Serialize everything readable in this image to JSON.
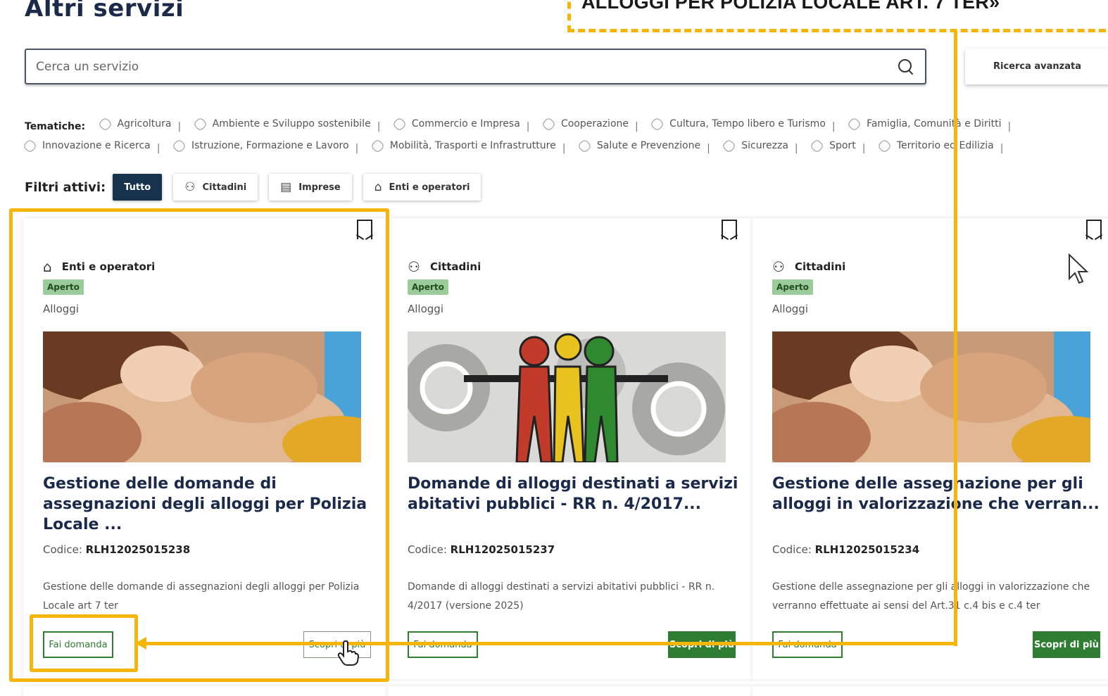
{
  "page": {
    "title": "Altri servizi"
  },
  "callout": {
    "text": "ALLOGGI PER POLIZIA LOCALE ART. 7 TER»"
  },
  "search": {
    "placeholder": "Cerca un servizio",
    "advanced_label": "Ricerca avanzata"
  },
  "themes": {
    "label": "Tematiche:",
    "items": [
      "Agricoltura",
      "Ambiente e Sviluppo sostenibile",
      "Commercio e Impresa",
      "Cooperazione",
      "Cultura, Tempo libero e Turismo",
      "Famiglia, Comunità e Diritti",
      "Innovazione e Ricerca",
      "Istruzione, Formazione e Lavoro",
      "Mobilità, Trasporti e Infrastrutture",
      "Salute e Prevenzione",
      "Sicurezza",
      "Sport",
      "Territorio ed Edilizia"
    ]
  },
  "filters": {
    "label": "Filtri attivi:",
    "all": "Tutto",
    "citizens": "Cittadini",
    "companies": "Imprese",
    "entities": "Enti e operatori"
  },
  "cards": [
    {
      "category": "Enti e operatori",
      "status": "Aperto",
      "type": "Alloggi",
      "title": "Gestione delle domande di assegnazioni degli alloggi per Polizia Locale ...",
      "code_label": "Codice:",
      "code": "RLH12025015238",
      "description": "Gestione delle domande di assegnazioni degli alloggi per Polizia Locale art 7 ter",
      "apply_label": "Fai domanda",
      "more_label": "Scopri di più"
    },
    {
      "category": "Cittadini",
      "status": "Aperto",
      "type": "Alloggi",
      "title": "Domande di alloggi destinati a servizi abitativi pubblici - RR n. 4/2017...",
      "code_label": "Codice:",
      "code": "RLH12025015237",
      "description": "Domande di alloggi destinati a servizi abitativi pubblici - RR n. 4/2017 (versione 2025)",
      "apply_label": "Fai domanda",
      "more_label": "Scopri di più"
    },
    {
      "category": "Cittadini",
      "status": "Aperto",
      "type": "Alloggi",
      "title": "Gestione delle assegnazione per gli alloggi in valorizzazione che verran...",
      "code_label": "Codice:",
      "code": "RLH12025015234",
      "description": "Gestione delle assegnazione per gli alloggi in valorizzazione che verranno effettuate ai sensi del Art.31 c.4 bis e c.4 ter",
      "apply_label": "Fai domanda",
      "more_label": "Scopri di più"
    }
  ],
  "colors": {
    "accent": "#f5b50a",
    "primary": "#17324d",
    "green": "#2e7d32",
    "badge": "#9ccb9b"
  }
}
